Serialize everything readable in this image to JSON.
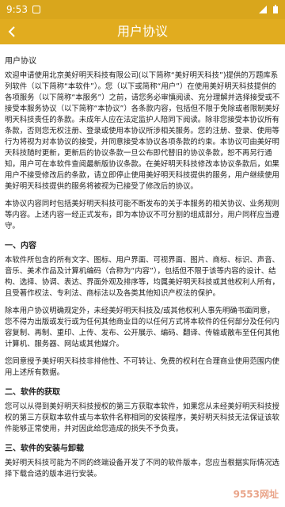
{
  "statusbar": {
    "time": "9:53"
  },
  "appbar": {
    "title": "用户协议"
  },
  "doc": {
    "heading": "用户协议",
    "paragraphs": [
      "欢迎申请使用北京美好明天科技有限公司(以下简称“美好明天科技”)提供的万题库系列软件（以下简称“本软件”）。您（以下或简称“用户”）在使用美好明天科技提供的各项服务（以下简称“本服务”）之前，请您务必审慎阅读、充分理解并选择接受或不接受本服务协议（以下简称“本协议”）各条款内容，包括但不限于免除或者限制美好明天科技责任的条款。未成年人应在法定监护人陪同下阅读。除非您接受本协议所有条款，否则您无权注册、登录或使用本协议所涉相关服务。您的注册、登录、使用等行为将视为对本协议的接受，并同意接受本协议各项条款的约束。本协议可由美好明天科技随时更新，更新后的协议条款一旦公布即代替旧的协议条款，恕不再另行通知，用户可在本软件查阅最新版协议条款。在美好明天科技修改本协议条款后，如果用户不接受修改后的条款，请立即停止使用美好明天科技提供的服务，用户继续使用美好明天科技提供的服务将被视为已接受了修改后的协议。",
      "本协议内容同时包括美好明天科技可能不断发布的关于本服务的相关协议、业务规则等内容。上述内容一经正式发布，即为本协议不可分割的组成部分，用户同样应当遵守。"
    ],
    "sections": [
      {
        "title": "一、内容",
        "paragraphs": [
          "本软件所包含的所有文字、图标、用户界面、可视界面、图片、商标、标识、声音、音乐、美术作品及计算机编码（合称为“内容”），包括但不限于该等内容的设计、结构、选择、协调、表达、界面外观及排序等，均属美好明天科技或其他权利人所有，且受著作权法、专利法、商标法以及各类其他知识产权法的保护。",
          "除本用户协议明确规定外，未经美好明天科技及/或其他权利人事先明确书面同意，您不得为出版或发行或为任何其他商业目的以任何方式将本软件的任何部分及任何内容复制、再制、重印、上传、发布、公开展示、编码、翻译、传输或散布至任何其他计算机、服务器、网站或其他媒介。",
          "您同意授予美好明天科技非排他性、不可转让、免费的权利在合理商业使用范围内使用上述所有数据。"
        ]
      },
      {
        "title": "二、软件的获取",
        "paragraphs": [
          "您可以从得到美好明天科技授权的第三方获取本软件，如果您从未经美好明天科技授权的第三方获取本软件或与本软件名称相同的安装程序，美好明天科技无法保证该软件能够正常使用，并对因此给您造成的损失不予负责。"
        ]
      },
      {
        "title": "三、软件的安装与卸载",
        "paragraphs": [
          "美好明天科技可能为不同的终端设备开发了不同的软件版本，您应当根据实际情况选择下载合适的版本进行安装。"
        ]
      }
    ]
  },
  "watermark": {
    "text": "9553网址"
  }
}
